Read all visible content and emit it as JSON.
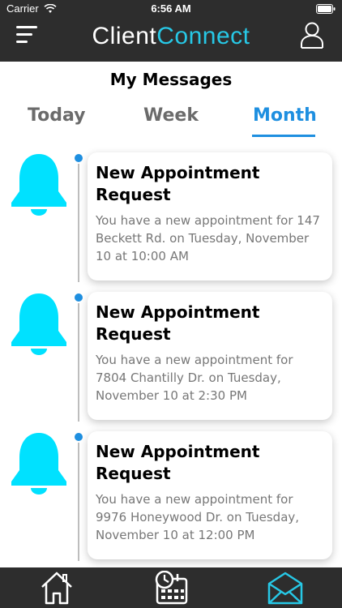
{
  "status_bar": {
    "carrier": "Carrier",
    "time": "6:56 AM"
  },
  "header": {
    "logo_part1": "Client",
    "logo_part2": "Connect",
    "menu_icon": "hamburger-icon",
    "profile_icon": "user-icon"
  },
  "page": {
    "title": "My Messages"
  },
  "tabs": [
    {
      "label": "Today",
      "active": false
    },
    {
      "label": "Week",
      "active": false
    },
    {
      "label": "Month",
      "active": true
    }
  ],
  "messages": [
    {
      "title": "New Appointment Request",
      "body": "You have a new appointment for 147 Beckett Rd. on Tuesday, November 10 at 10:00 AM",
      "icon": "bell-icon"
    },
    {
      "title": "New Appointment Request",
      "body": "You have a new appointment for 7804 Chantilly Dr. on Tuesday, November 10 at 2:30 PM",
      "icon": "bell-icon"
    },
    {
      "title": "New Appointment Request",
      "body": "You have a new appointment for 9976 Honeywood Dr. on Tuesday, November 10 at 12:00 PM",
      "icon": "bell-icon"
    }
  ],
  "bottom_nav": [
    {
      "icon": "home-icon",
      "active": false
    },
    {
      "icon": "calendar-clock-icon",
      "active": false
    },
    {
      "icon": "mail-icon",
      "active": true
    }
  ],
  "colors": {
    "header_bg": "#2d2d2d",
    "accent_cyan": "#27c8e6",
    "bell_cyan": "#00e1ff",
    "active_tab": "#1e8fe0",
    "body_text": "#777777"
  }
}
